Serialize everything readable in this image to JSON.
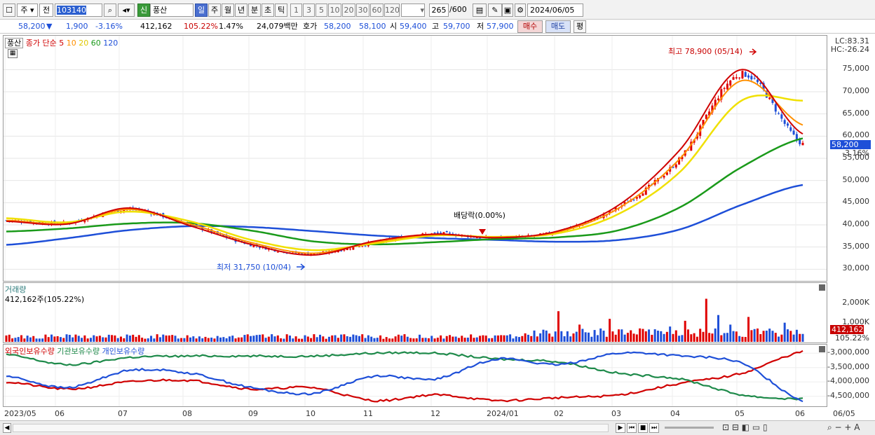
{
  "toolbar": {
    "menu_glyph": "☐",
    "market_label": "주",
    "period_label": "전",
    "code_value": "103140",
    "stock_tag": "신",
    "stock_name": "풍산",
    "timeframes": [
      "일",
      "주",
      "월",
      "년",
      "분",
      "초",
      "틱"
    ],
    "active_timeframe": "일",
    "intervals": [
      "1",
      "3",
      "5",
      "10",
      "20",
      "30",
      "60",
      "120"
    ],
    "count_value": "265",
    "count_total": "/600",
    "date_value": "2024/06/05"
  },
  "quote": {
    "price": "58,200",
    "direction": "▼",
    "change": "1,900",
    "change_pct": "-3.16%",
    "volume": "412,162",
    "volume_ratio": "105.22%",
    "turnover": "1.47%",
    "amount": "24,079백만",
    "hoga_label": "호가",
    "ask": "58,200",
    "bid": "58,100",
    "open_label": "시",
    "open": "59,400",
    "high_label": "고",
    "high": "59,700",
    "low_label": "저",
    "low": "57,900",
    "buy_label": "매수",
    "sell_label": "매도",
    "eval_label": "평"
  },
  "price_panel": {
    "stock_label": "풍산",
    "legend_title": "종가 단순",
    "ma_periods": [
      "5",
      "10",
      "20",
      "60",
      "120"
    ],
    "ma_colors": [
      "#d00000",
      "#ff9000",
      "#f0e000",
      "#1a9a1a",
      "#1e4fd8"
    ],
    "lc_label": "LC:83.31",
    "hc_label": "HC:-26.24",
    "price_tag": "58,200",
    "price_tag_pct": "-3.16%",
    "high_annotation": "최고 78,900 (05/14)",
    "low_annotation": "최저 31,750 (10/04)",
    "dividend_annotation": "배당락(0.00%)"
  },
  "volume_panel": {
    "title": "거래량",
    "summary": "412,162주(105.22%)",
    "tag_value": "412,162",
    "tag_pct": "105.22%"
  },
  "holding_panel": {
    "legend": [
      "외국인보유수량",
      "기관보유수량",
      "개인보유수량"
    ],
    "colors": [
      "#d00000",
      "#1e8a4a",
      "#1e4fd8"
    ]
  },
  "x_axis": {
    "labels": [
      "2023/05",
      "06",
      "07",
      "08",
      "09",
      "10",
      "11",
      "12",
      "2024/01",
      "02",
      "03",
      "04",
      "05",
      "06",
      "06/05"
    ]
  },
  "chart_data": [
    {
      "type": "line",
      "title": "",
      "series_kind": "candlestick with moving averages",
      "ylim": [
        28000,
        82000
      ],
      "y_ticks": [
        30000,
        35000,
        40000,
        45000,
        50000,
        55000,
        60000,
        65000,
        70000,
        75000
      ],
      "y_tick_labels": [
        "30,000",
        "35,000",
        "40,000",
        "45,000",
        "50,000",
        "55,000",
        "60,000",
        "65,000",
        "70,000",
        "75,000"
      ],
      "x": [
        "2023/05",
        "06",
        "07",
        "08",
        "09",
        "10",
        "11",
        "12",
        "2024/01",
        "02",
        "03",
        "04",
        "05",
        "06"
      ],
      "close_approx": [
        41000,
        40500,
        43500,
        40000,
        35500,
        33500,
        36000,
        38000,
        37000,
        38500,
        44000,
        55000,
        74000,
        58200
      ],
      "series": [
        {
          "name": "5",
          "values": [
            40800,
            40200,
            43800,
            39800,
            35600,
            33200,
            36300,
            37900,
            37100,
            38600,
            44500,
            57000,
            75000,
            60500
          ]
        },
        {
          "name": "10",
          "values": [
            41000,
            40300,
            43500,
            40200,
            36000,
            33600,
            36100,
            37800,
            37200,
            38400,
            43800,
            55000,
            72500,
            62500
          ]
        },
        {
          "name": "20",
          "values": [
            41500,
            40600,
            43000,
            40800,
            36600,
            34300,
            35800,
            37600,
            37300,
            38100,
            42500,
            52000,
            68000,
            68000
          ]
        },
        {
          "name": "60",
          "values": [
            38500,
            39200,
            40300,
            40400,
            38700,
            36300,
            35600,
            36100,
            36800,
            37200,
            38800,
            44000,
            53000,
            59500
          ]
        },
        {
          "name": "120",
          "values": [
            35500,
            37000,
            38800,
            39700,
            39500,
            38600,
            37600,
            37000,
            36600,
            36200,
            36600,
            39000,
            44500,
            49000
          ]
        }
      ],
      "annotations": [
        {
          "text": "최고 78,900 (05/14)",
          "x": "05/14",
          "y": 78900
        },
        {
          "text": "최저 31,750 (10/04)",
          "x": "10/04",
          "y": 31750
        },
        {
          "text": "배당락(0.00%)",
          "x": "2023/12",
          "y": 38800
        }
      ]
    },
    {
      "type": "bar",
      "title": "거래량",
      "ylim": [
        0,
        3000000
      ],
      "y_ticks": [
        1000000,
        2000000
      ],
      "y_tick_labels": [
        "1,000K",
        "2,000K"
      ],
      "last_value": 412162
    },
    {
      "type": "line",
      "title": "",
      "ylim": [
        -4800000,
        -2800000
      ],
      "y_ticks": [
        -3000000,
        -3500000,
        -4000000,
        -4500000
      ],
      "y_tick_labels": [
        "-3,000,000",
        "-3,500,000",
        "-4,000,000",
        "-4,500,000"
      ],
      "series": [
        {
          "name": "외국인보유수량",
          "values": [
            -4000000,
            -4250000,
            -4000000,
            -3950000,
            -4250000,
            -4200000,
            -4650000,
            -4450000,
            -4650000,
            -4550000,
            -4450000,
            -4050000,
            -3700000,
            -2950000
          ]
        },
        {
          "name": "기관보유수량",
          "values": [
            -3050000,
            -3400000,
            -3150000,
            -3100000,
            -3100000,
            -3100000,
            -3000000,
            -3000000,
            -3200000,
            -3300000,
            -3700000,
            -3900000,
            -4450000,
            -4600000
          ]
        },
        {
          "name": "개인보유수량",
          "values": [
            -3800000,
            -4200000,
            -3600000,
            -3700000,
            -4200000,
            -4400000,
            -3800000,
            -3900000,
            -3200000,
            -3400000,
            -3000000,
            -3100000,
            -3350000,
            -4650000
          ]
        }
      ]
    }
  ]
}
